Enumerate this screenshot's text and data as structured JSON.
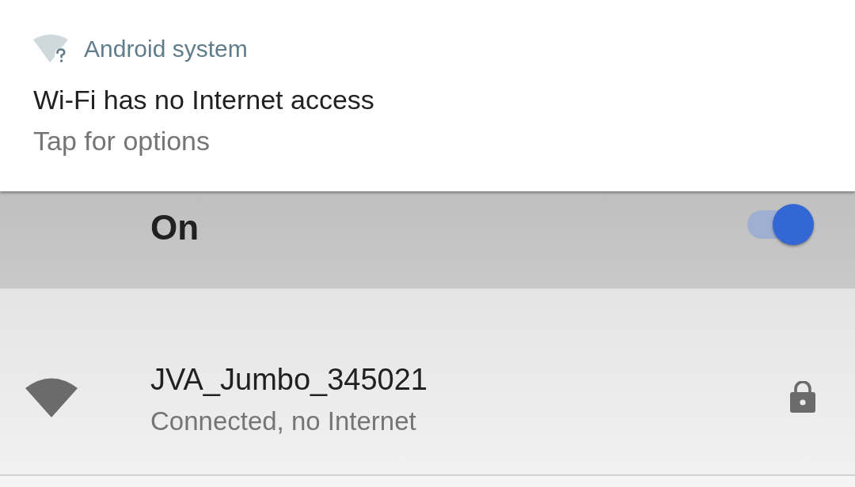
{
  "notification": {
    "app_name": "Android system",
    "title": "Wi-Fi has no Internet access",
    "text": "Tap for options"
  },
  "wifi_switch": {
    "label": "On",
    "on": true
  },
  "networks": [
    {
      "name": "JVA_Jumbo_345021",
      "status": "Connected, no Internet",
      "secured": true
    }
  ]
}
